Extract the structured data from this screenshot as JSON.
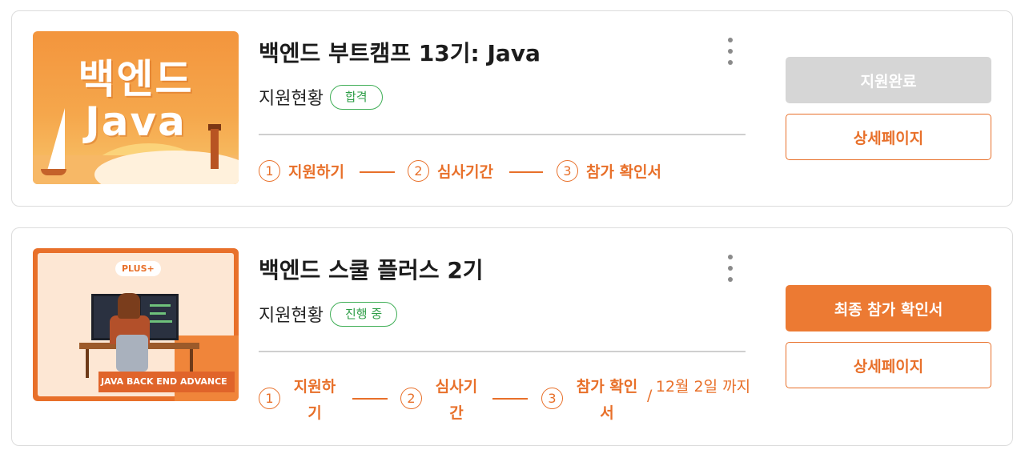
{
  "applications": [
    {
      "title": "백엔드 부트캠프 13기: Java",
      "thumbnail": {
        "line1": "백엔드",
        "line2": "Java"
      },
      "status_label": "지원현황",
      "status_badge": "합격",
      "steps": [
        {
          "num": "1",
          "label": "지원하기"
        },
        {
          "num": "2",
          "label": "심사기간"
        },
        {
          "num": "3",
          "label": "참가 확인서"
        }
      ],
      "primary_button": "지원완료",
      "primary_button_state": "disabled",
      "detail_button": "상세페이지"
    },
    {
      "title": "백엔드 스쿨 플러스 2기",
      "thumbnail": {
        "badge": "PLUS+",
        "caption": "JAVA BACK END ADVANCE"
      },
      "status_label": "지원현황",
      "status_badge": "진행 중",
      "steps": [
        {
          "num": "1",
          "label": "지원하기"
        },
        {
          "num": "2",
          "label": "심사기간"
        },
        {
          "num": "3",
          "label": "참가 확인서"
        }
      ],
      "separator": "/",
      "deadline": "12월 2일 까지",
      "primary_button": "최종 참가 확인서",
      "primary_button_state": "active",
      "detail_button": "상세페이지"
    }
  ],
  "colors": {
    "accent": "#e8702a",
    "badge_green": "#2e9e47",
    "disabled": "#d6d6d6"
  }
}
